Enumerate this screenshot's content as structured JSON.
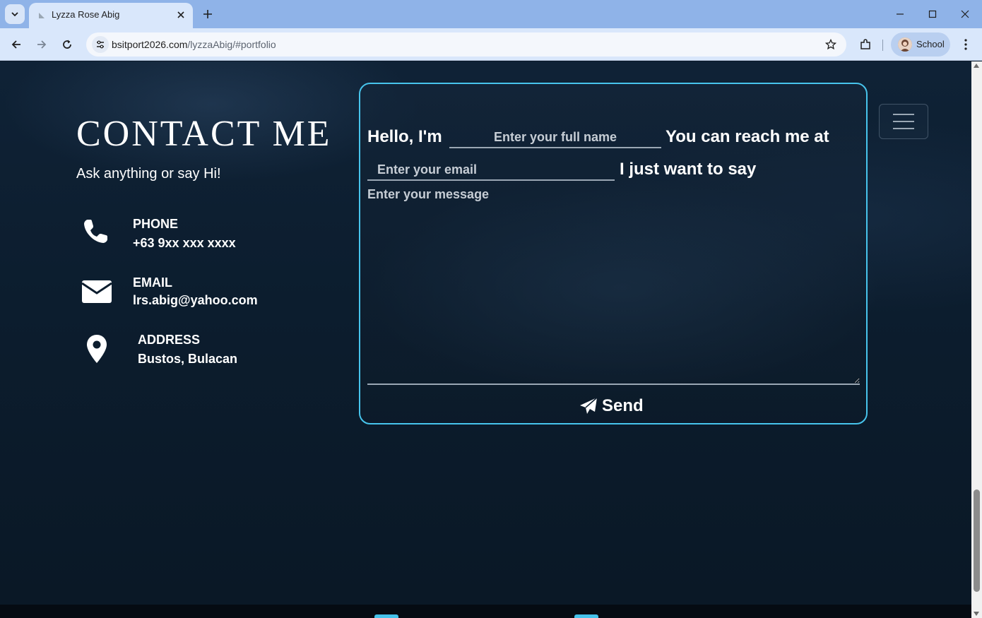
{
  "browser": {
    "tab_title": "Lyzza Rose Abig",
    "url_host": "bsitport2026.com",
    "url_path": "/lyzzaAbig/#portfolio",
    "profile_label": "School"
  },
  "contact": {
    "title": "CONTACT ME",
    "subtitle": "Ask anything or say Hi!",
    "items": [
      {
        "label": "PHONE",
        "value": "+63 9xx xxx xxxx",
        "icon": "phone-icon"
      },
      {
        "label": "EMAIL",
        "value": "lrs.abig@yahoo.com",
        "icon": "envelope-icon"
      },
      {
        "label": "ADDRESS",
        "value": "Bustos, Bulacan",
        "icon": "map-pin-icon"
      }
    ]
  },
  "form": {
    "hello_text": "Hello, I'm",
    "name_placeholder": "Enter your full name",
    "reach_text": "You can reach me at",
    "email_placeholder": "Enter your email",
    "say_text": "I just want to say",
    "message_placeholder": "Enter your message",
    "send_label": "Send"
  },
  "colors": {
    "accent": "#47c4ec",
    "background": "#0c1d2e",
    "text": "#ffffff"
  }
}
